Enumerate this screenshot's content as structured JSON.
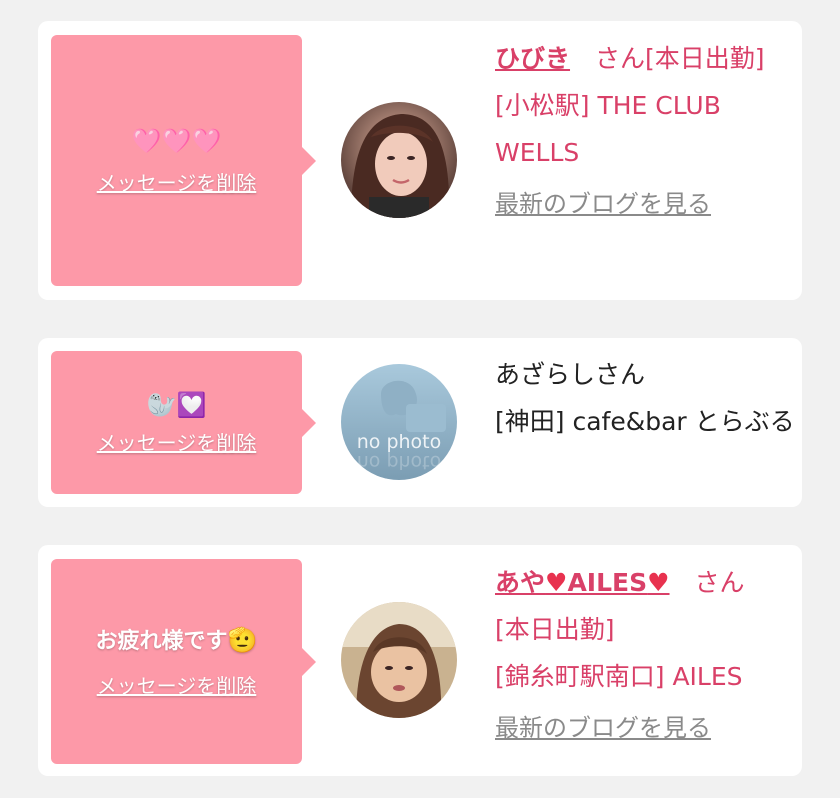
{
  "messages": [
    {
      "emoji": "🩷🩷🩷",
      "delete_label": "メッセージを削除",
      "name": "ひびき",
      "name_suffix": "　さん[本日出勤]",
      "shop": "[小松駅] THE CLUB WELLS",
      "blog_label": "最新のブログを見る"
    },
    {
      "emoji": "🦭💟",
      "delete_label": "メッセージを削除",
      "name_plain": "あざらしさん",
      "shop": "[神田] cafe&bar とらぶる",
      "avatar_text": "no photo"
    },
    {
      "message_text": "お疲れ様です",
      "emoji": "🫡",
      "delete_label": "メッセージを削除",
      "name_part1": "あや",
      "name_part2": "AILES",
      "name_suffix": "　さん",
      "name_heart": "♥",
      "line2": "[本日出勤]",
      "shop": "[錦糸町駅南口] AILES",
      "blog_label": "最新のブログを見る"
    }
  ],
  "colors": {
    "bubble": "#fd99a8",
    "accent": "#d94068",
    "background": "#f1f1f1"
  }
}
